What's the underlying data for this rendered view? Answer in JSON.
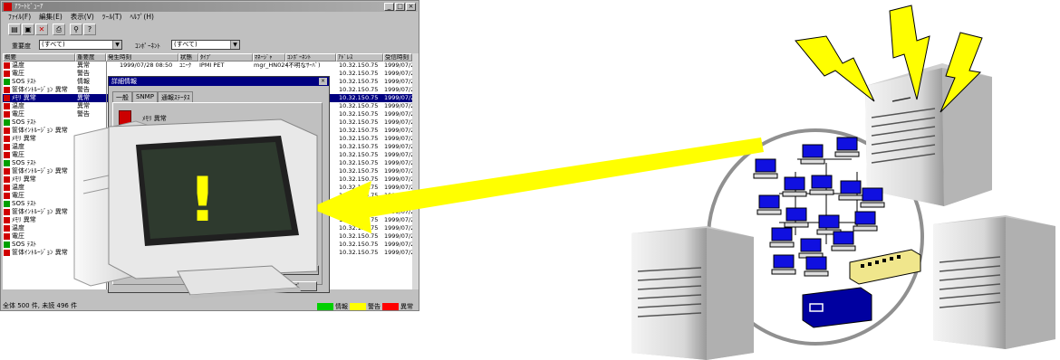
{
  "window": {
    "title": "ｱﾗｰﾄﾋﾞｭｰｱ",
    "min": "_",
    "max": "□",
    "close": "×"
  },
  "menu": [
    "ﾌｧｲﾙ(F)",
    "編集(E)",
    "表示(V)",
    "ﾂｰﾙ(T)",
    "ﾍﾙﾌﾟ(H)"
  ],
  "toolbar_icons": [
    "open-icon",
    "save-icon",
    "delete-icon",
    "print-icon",
    "find-icon",
    "help-icon"
  ],
  "toolbar_glyphs": [
    "▤",
    "▣",
    "✕",
    "⎙",
    "⚲",
    "?"
  ],
  "filter": {
    "severity_label": "重要度",
    "severity_value": "(すべて)",
    "component_label": "ｺﾝﾎﾟｰﾈﾝﾄ",
    "component_value": "(すべて)"
  },
  "columns": [
    "概要",
    "重要度",
    "発生時刻",
    "状態",
    "ﾀｲﾌﾟ",
    "ﾏﾈｰｼﾞｬ",
    "ｺﾝﾎﾟｰﾈﾝﾄ",
    "ｱﾄﾞﾚｽ",
    "受信時刻"
  ],
  "list": [
    {
      "name": "温度",
      "sev": "異常",
      "c": "#d00000"
    },
    {
      "name": "電圧",
      "sev": "警告",
      "c": "#d00000"
    },
    {
      "name": "SOS ﾃｽﾄ",
      "sev": "情報",
      "c": "#00a000"
    },
    {
      "name": "筐体ｲﾝﾄﾙｰｼﾞｮﾝ 異常",
      "sev": "警告",
      "c": "#d00000"
    },
    {
      "name": "ﾒﾓﾘ 異常",
      "sev": "異常",
      "c": "#d00000"
    },
    {
      "name": "温度",
      "sev": "異常",
      "c": "#d00000"
    },
    {
      "name": "電圧",
      "sev": "警告",
      "c": "#d00000"
    },
    {
      "name": "SOS ﾃｽﾄ",
      "sev": "",
      "c": "#00a000"
    },
    {
      "name": "筐体ｲﾝﾄﾙｰｼﾞｮﾝ 異常",
      "sev": "",
      "c": "#d00000"
    },
    {
      "name": "ﾒﾓﾘ 異常",
      "sev": "",
      "c": "#d00000"
    },
    {
      "name": "温度",
      "sev": "",
      "c": "#d00000"
    },
    {
      "name": "電圧",
      "sev": "",
      "c": "#d00000"
    },
    {
      "name": "SOS ﾃｽﾄ",
      "sev": "",
      "c": "#00a000"
    },
    {
      "name": "筐体ｲﾝﾄﾙｰｼﾞｮﾝ 異常",
      "sev": "",
      "c": "#d00000"
    },
    {
      "name": "ﾒﾓﾘ 異常",
      "sev": "",
      "c": "#d00000"
    },
    {
      "name": "温度",
      "sev": "",
      "c": "#d00000"
    },
    {
      "name": "電圧",
      "sev": "",
      "c": "#d00000"
    },
    {
      "name": "SOS ﾃｽﾄ",
      "sev": "",
      "c": "#00a000"
    },
    {
      "name": "筐体ｲﾝﾄﾙｰｼﾞｮﾝ 異常",
      "sev": "",
      "c": "#d00000"
    },
    {
      "name": "ﾒﾓﾘ 異常",
      "sev": "",
      "c": "#d00000"
    },
    {
      "name": "温度",
      "sev": "",
      "c": "#d00000"
    },
    {
      "name": "電圧",
      "sev": "",
      "c": "#d00000"
    },
    {
      "name": "SOS ﾃｽﾄ",
      "sev": "",
      "c": "#00a000"
    },
    {
      "name": "筐体ｲﾝﾄﾙｰｼﾞｮﾝ 異常",
      "sev": "",
      "c": "#d00000"
    }
  ],
  "first_row": {
    "time": "1999/07/28 08:50",
    "state": "ﾕﾆｰｸ",
    "type": "IPMI PET",
    "manager": "mgr_HN024",
    "component": "(不明なｻｰﾊﾞ)"
  },
  "address": "10.32.150.75",
  "received": "1999/07/2",
  "dialog": {
    "title": "詳細情報",
    "close": "×",
    "tabs": [
      "一般",
      "SNMP",
      "通報ｽﾃｰﾀｽ"
    ],
    "message": "ﾒﾓﾘ 異常",
    "btn_help": "ﾍﾙﾌﾟ",
    "btn_action": "処理(A)"
  },
  "status": {
    "text": "全体 500 件, 未読 496 件",
    "legend": [
      {
        "label": "情報",
        "color": "#00d000"
      },
      {
        "label": "警告",
        "color": "#ffff00"
      },
      {
        "label": "異常",
        "color": "#ff0000"
      }
    ]
  },
  "monitor_icon": "!",
  "colors": {
    "bolt": "#ffff00",
    "bolt_stroke": "#000000",
    "arrow": "#ffff00",
    "circle": "#909090",
    "lan_screen": "#1010e0",
    "hub": "#f0e68c",
    "router": "#0000a0"
  }
}
